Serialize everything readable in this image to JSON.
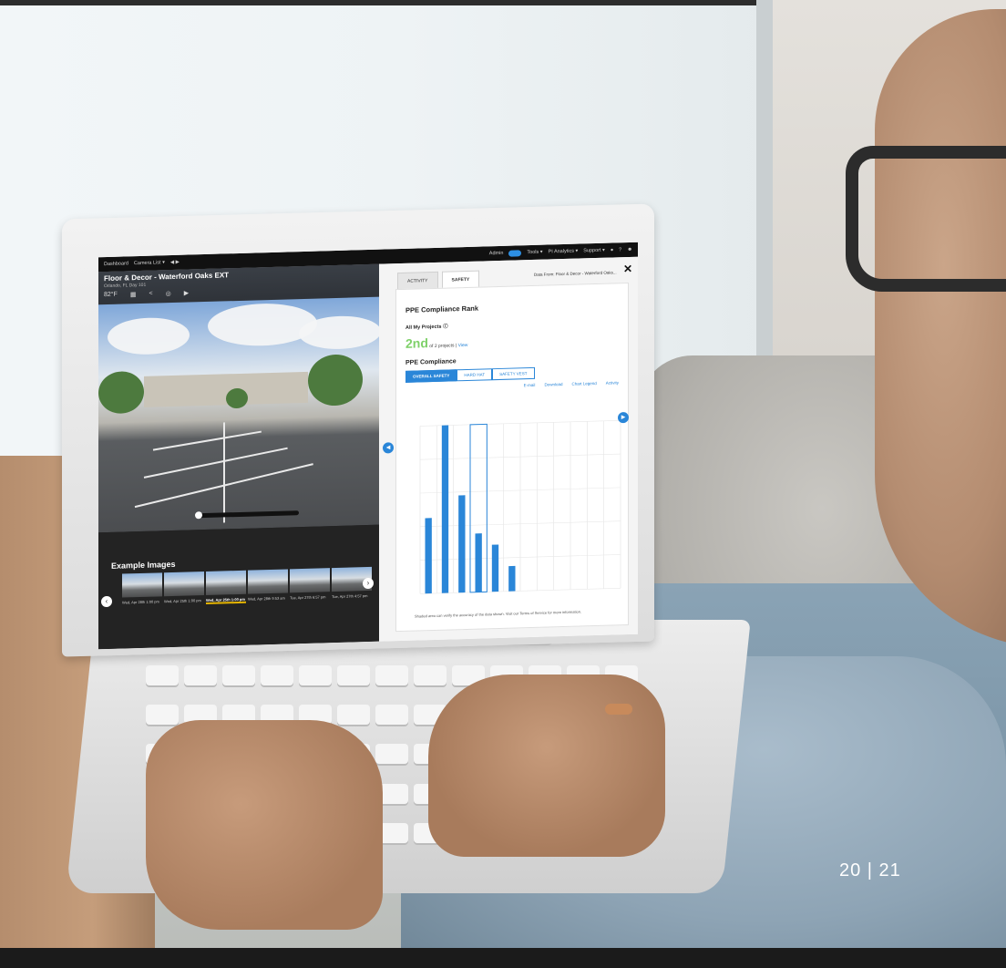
{
  "page_number": "20  |  21",
  "screen": {
    "nav": {
      "dashboard": "Dashboard",
      "camera_list": "Camera List ▾",
      "admin": "Admin",
      "tools": "Tools ▾",
      "pi_analytics": "PI Analytics ▾",
      "support": "Support ▾"
    },
    "camera": {
      "title": "Floor & Decor - Waterford Oaks EXT",
      "subtitle": "Orlando, FL   Day 101",
      "temp": "82°F"
    },
    "examples": {
      "heading": "Example Images",
      "thumbs": [
        "Wed, Apr 28th 1:00 pm",
        "Wed, Apr 25th 1:00 pm",
        "Wed, Apr 25th 1:00 pm",
        "Wed, Apr 28th 9:53 am",
        "Tue, Apr 27th 6:57 pm",
        "Tue, Apr 27th 4:57 pm"
      ]
    },
    "panel": {
      "tab_activity": "ACTIVITY",
      "tab_safety": "SAFETY",
      "data_from": "Data From:  Floor & Decor - Waterford Oaks...",
      "rank_heading": "PPE Compliance Rank",
      "all_projects": "All My Projects",
      "rank": "2nd",
      "rank_of": "of 2 projects",
      "view": "View",
      "compliance_heading": "PPE Compliance",
      "seg_overall": "OVERALL SAFETY",
      "seg_hardhat": "HARD HAT",
      "seg_vest": "SAFETY VEST",
      "email": "E-mail",
      "download": "Download",
      "chart_legend": "Chart Legend",
      "activity": "Activity",
      "footnote": "Shaded area can verify the accuracy of the data shown. Visit our Terms of Service for more information."
    }
  },
  "chart_data": {
    "type": "bar",
    "values": [
      45,
      100,
      58,
      35,
      28,
      15,
      0,
      0,
      0,
      0,
      0,
      0
    ],
    "highlight_index": 3,
    "ylim": [
      0,
      100
    ]
  }
}
